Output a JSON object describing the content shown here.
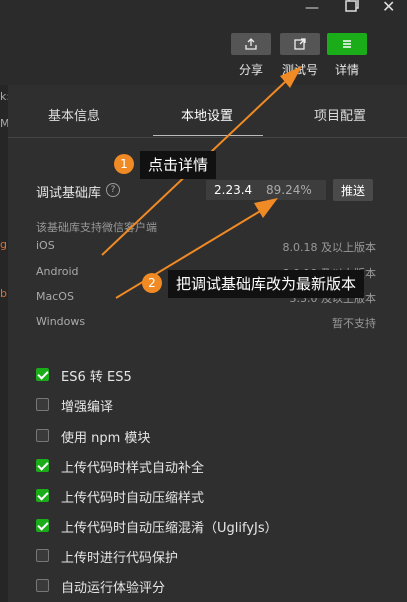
{
  "toolbar": {
    "share_label": "分享",
    "test_label": "测试号",
    "details_label": "详情"
  },
  "tabs": {
    "basic": "基本信息",
    "local": "本地设置",
    "project": "项目配置"
  },
  "lib": {
    "title": "调试基础库",
    "help": "?",
    "version": "2.23.4",
    "percent": "89.24%",
    "push_label": "推送",
    "support_note": "该基础库支持微信客户端",
    "clients": [
      {
        "name": "iOS",
        "version": "8.0.18 及以上版本"
      },
      {
        "name": "Android",
        "version": "8.0.19 及以上版本"
      },
      {
        "name": "MacOS",
        "version": "3.3.0 及以上版本"
      },
      {
        "name": "Windows",
        "version": "暂不支持"
      }
    ]
  },
  "options": [
    {
      "label": "ES6 转 ES5",
      "checked": true
    },
    {
      "label": "增强编译",
      "checked": false
    },
    {
      "label": "使用 npm 模块",
      "checked": false
    },
    {
      "label": "上传代码时样式自动补全",
      "checked": true
    },
    {
      "label": "上传代码时自动压缩样式",
      "checked": true
    },
    {
      "label": "上传代码时自动压缩混淆（UglifyJs）",
      "checked": true
    },
    {
      "label": "上传时进行代码保护",
      "checked": false
    },
    {
      "label": "自动运行体验评分",
      "checked": false
    }
  ],
  "annotations": {
    "step1_num": "1",
    "step1_text": "点击详情",
    "step2_num": "2",
    "step2_text": "把调试基础库改为最新版本"
  },
  "left_edge": {
    "glyph_a": "k:",
    "glyph_b": "M",
    "glyph_c": "g",
    "glyph_d": "b"
  },
  "colors": {
    "accent_green": "#1aad19",
    "annotation_orange": "#f08a24"
  }
}
